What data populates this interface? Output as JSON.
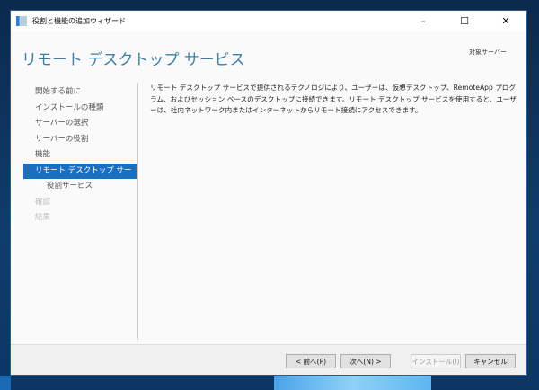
{
  "window": {
    "title": "役割と機能の追加ウィザード",
    "minimize": "–",
    "maximize": "☐",
    "close": "✕"
  },
  "header": {
    "title": "リモート デスクトップ サービス",
    "target_server_label": "対象サーバー"
  },
  "nav": {
    "items": [
      {
        "label": "開始する前に"
      },
      {
        "label": "インストールの種類"
      },
      {
        "label": "サーバーの選択"
      },
      {
        "label": "サーバーの役割"
      },
      {
        "label": "機能"
      },
      {
        "label": "リモート デスクトップ サービス"
      },
      {
        "label": "役割サービス"
      },
      {
        "label": "確認"
      },
      {
        "label": "結果"
      }
    ]
  },
  "description": "リモート デスクトップ サービスで提供されるテクノロジにより、ユーザーは、仮想デスクトップ、RemoteApp プログラム、およびセッション ベースのデスクトップに接続できます。リモート デスクトップ サービスを使用すると、ユーザーは、社内ネットワーク内またはインターネットからリモート接続にアクセスできます。",
  "footer": {
    "prev": "< 前へ(P)",
    "next": "次へ(N) >",
    "install": "インストール(I)",
    "cancel": "キャンセル"
  }
}
